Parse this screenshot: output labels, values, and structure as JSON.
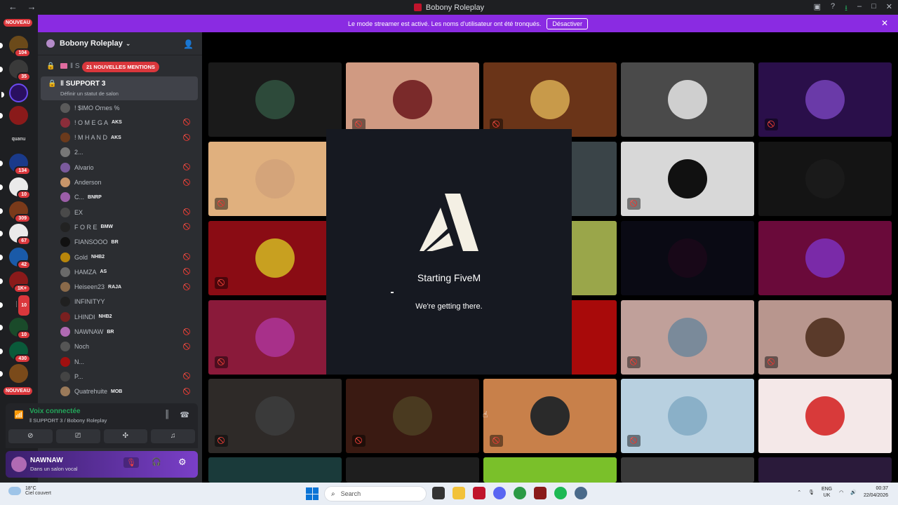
{
  "window": {
    "title": "Bobony Roleplay",
    "back_icon": "←",
    "forward_icon": "→"
  },
  "banner": {
    "text": "Le mode streamer est activé. Les noms d'utilisateur ont été tronqués.",
    "button": "Désactiver",
    "close": "✕"
  },
  "servers": {
    "new_label_top": "NOUVEAU",
    "new_label_bottom": "NOUVEAU",
    "badges": [
      "104",
      "35",
      "134",
      "10",
      "309",
      "67",
      "42",
      "1K+",
      "10",
      "10",
      "430"
    ],
    "text_label": "quanu"
  },
  "guild": {
    "name": "Bobony Roleplay",
    "mentions_badge": "21 NOUVELLES MENTIONS",
    "locked_channel_name": "‖ S",
    "current_channel": {
      "name": "‖ SUPPORT 3",
      "status_placeholder": "Définir un statut de salon"
    }
  },
  "members": [
    {
      "name": "! $IMO Ornes %",
      "tag": "",
      "color": "#5a5a5a",
      "muted": false
    },
    {
      "name": "! O M E G A",
      "tag": "AKS",
      "color": "#8b2d3a",
      "muted": true
    },
    {
      "name": "! M H A N D",
      "tag": "AKS",
      "color": "#6b3a1c",
      "muted": true
    },
    {
      "name": "2...",
      "tag": "",
      "color": "#777777",
      "muted": false
    },
    {
      "name": "Alvario",
      "tag": "",
      "color": "#7a5a9c",
      "muted": true
    },
    {
      "name": "Anderson",
      "tag": "",
      "color": "#c8956a",
      "muted": true
    },
    {
      "name": "C...",
      "tag": "BNRP",
      "color": "#9c5ea8",
      "muted": false
    },
    {
      "name": "EX",
      "tag": "",
      "color": "#4a4a4a",
      "muted": true
    },
    {
      "name": "F O R E",
      "tag": "BMW",
      "color": "#222222",
      "muted": true
    },
    {
      "name": "FIANSOOO",
      "tag": "BR",
      "color": "#111111",
      "muted": false
    },
    {
      "name": "Gold",
      "tag": "NHB2",
      "color": "#b8860b",
      "muted": true
    },
    {
      "name": "HAMZA",
      "tag": "AS",
      "color": "#6a6a6a",
      "muted": true
    },
    {
      "name": "Heiseen23",
      "tag": "RAJA",
      "color": "#8a6a4a",
      "muted": true
    },
    {
      "name": "INFINITYY",
      "tag": "",
      "color": "#202020",
      "muted": false
    },
    {
      "name": "LHINDI",
      "tag": "NHB2",
      "color": "#7a2020",
      "muted": false
    },
    {
      "name": "NAWNAW",
      "tag": "BR",
      "color": "#b06ab3",
      "muted": true
    },
    {
      "name": "Noch",
      "tag": "",
      "color": "#555555",
      "muted": true
    },
    {
      "name": "N...",
      "tag": "",
      "color": "#a01010",
      "muted": false
    },
    {
      "name": "P...",
      "tag": "",
      "color": "#444444",
      "muted": true
    },
    {
      "name": "Quatrehuite",
      "tag": "MOB",
      "color": "#9a7a5a",
      "muted": true
    }
  ],
  "voice": {
    "status": "Voix connectée",
    "location": "‖ SUPPORT 3 / Bobony Roleplay"
  },
  "user": {
    "name": "NAWNAW",
    "status": "Dans un salon vocal"
  },
  "fivem": {
    "title": "Starting FiveM",
    "subtitle": "We're getting there."
  },
  "tiles": [
    {
      "bg": "#1a1a1a",
      "pic": "#2d4a3a",
      "muted": false
    },
    {
      "bg": "#d09a82",
      "pic": "#7a2a2a",
      "muted": true
    },
    {
      "bg": "#6a3418",
      "pic": "#c89a4a",
      "muted": true
    },
    {
      "bg": "#4a4a4a",
      "pic": "#cfcfcf",
      "muted": false
    },
    {
      "bg": "#2a0f4a",
      "pic": "#6a3aa8",
      "muted": true
    },
    {
      "bg": "#e0b07e",
      "pic": "#d4a47a",
      "muted": true
    },
    {
      "bg": "#3a4448",
      "pic": "#3a4448",
      "muted": false
    },
    {
      "bg": "#d8d8d8",
      "pic": "#111111",
      "muted": true
    },
    {
      "bg": "#141414",
      "pic": "#1a1a1a",
      "muted": false
    },
    {
      "bg": "#8a0c14",
      "pic": "#c8a020",
      "muted": true
    },
    {
      "bg": "#9aa64a",
      "pic": "#9aa64a",
      "muted": false
    },
    {
      "bg": "#0a0a14",
      "pic": "#180818",
      "muted": false
    },
    {
      "bg": "#6a0a3a",
      "pic": "#7a2aa8",
      "muted": false
    },
    {
      "bg": "#8a1a3a",
      "pic": "#a8308a",
      "muted": true
    },
    {
      "bg": "#a80a0a",
      "pic": "#a80a0a",
      "muted": false
    },
    {
      "bg": "#c0a09a",
      "pic": "#7a8a9a",
      "muted": true
    },
    {
      "bg": "#b8968e",
      "pic": "#5a3a2a",
      "muted": true
    },
    {
      "bg": "#2e2a28",
      "pic": "#3a3a3a",
      "muted": true
    },
    {
      "bg": "#3a1a12",
      "pic": "#4a3a20",
      "muted": true
    },
    {
      "bg": "#c8804a",
      "pic": "#2a2a2a",
      "muted": true
    },
    {
      "bg": "#b8d0e0",
      "pic": "#8ab0c8",
      "muted": true
    },
    {
      "bg": "#f4e8e8",
      "pic": "#d83a3a",
      "muted": false
    }
  ],
  "taskbar": {
    "temperature": "18°C",
    "weather": "Ciel couvert",
    "search": "Search",
    "lang1": "ENG",
    "lang2": "UK",
    "time": "00:37",
    "date": "22/04/2026"
  }
}
